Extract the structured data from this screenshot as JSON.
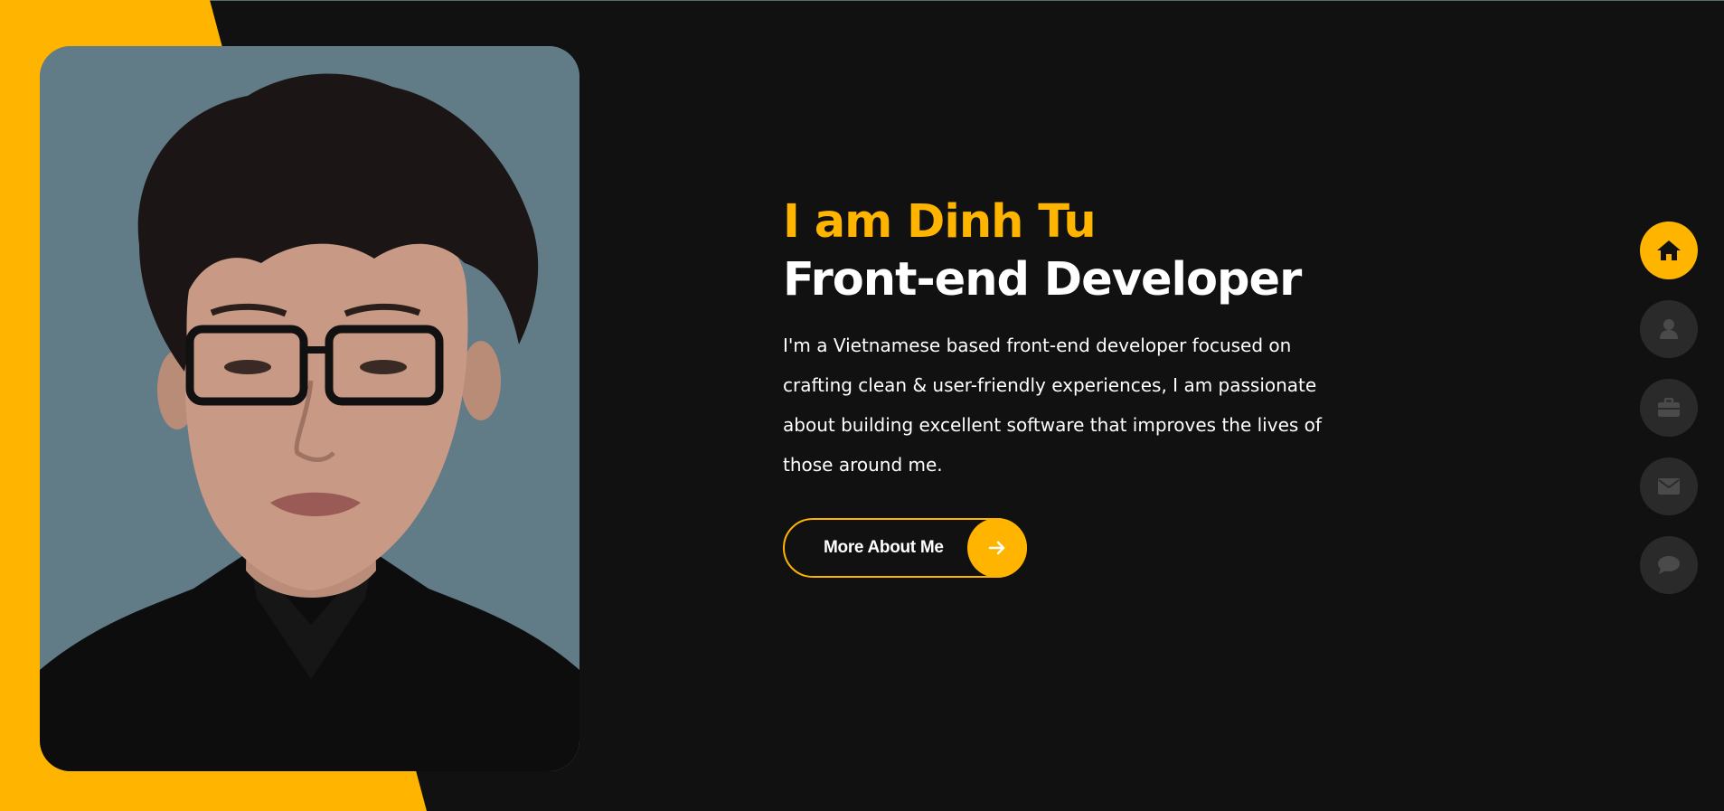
{
  "hero": {
    "greeting": "I am Dinh Tu",
    "role": "Front-end Developer",
    "description": "I'm a Vietnamese based front-end developer focused on crafting clean & user-friendly experiences, I am passionate about building excellent software that improves the lives of those around me.",
    "cta_label": "More About Me",
    "cta_icon": "arrow-right-icon"
  },
  "photo": {
    "alt": "Portrait photo"
  },
  "side_nav": [
    {
      "icon": "home-icon",
      "active": true
    },
    {
      "icon": "user-icon",
      "active": false
    },
    {
      "icon": "briefcase-icon",
      "active": false
    },
    {
      "icon": "envelope-icon",
      "active": false
    },
    {
      "icon": "comment-icon",
      "active": false
    }
  ],
  "colors": {
    "accent": "#ffb400",
    "background": "#111111",
    "nav_inactive": "#2b2a2a",
    "text": "#ffffff"
  }
}
